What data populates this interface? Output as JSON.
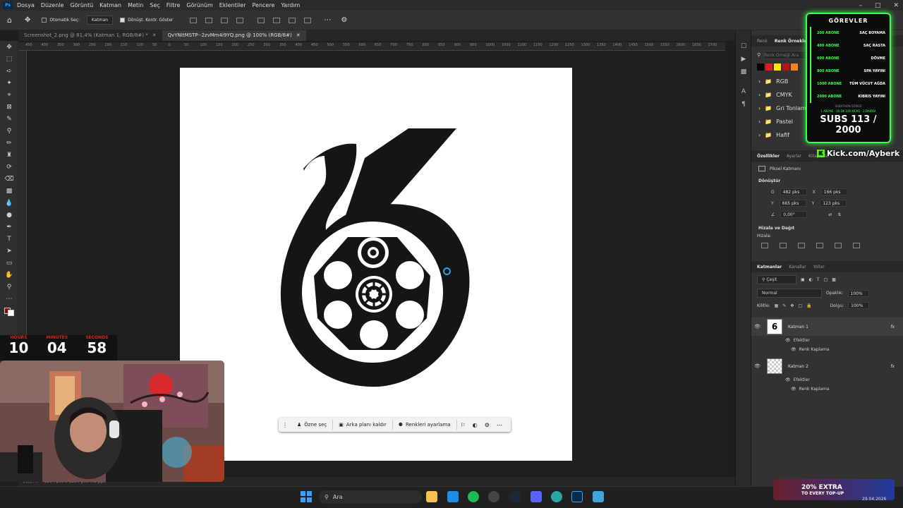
{
  "app": {
    "badge": "Ps"
  },
  "menu": [
    "Dosya",
    "Düzenle",
    "Görüntü",
    "Katman",
    "Metin",
    "Seç",
    "Filtre",
    "Görünüm",
    "Eklentiler",
    "Pencere",
    "Yardım"
  ],
  "options_bar": {
    "auto_select_label": "Otomatik Seç:",
    "auto_select_value": "Katman",
    "transform_controls_label": "Dönüşt. Kontr. Göster"
  },
  "tabs": [
    {
      "label": "Screenshot_2.png @ 81,4% (Katman 1, RGB/8#) *",
      "active": false
    },
    {
      "label": "QvYNItMSTP--2zvMm4i9YQ.png @ 100% (RGB/8#)",
      "active": true
    }
  ],
  "ruler_ticks": [
    "450",
    "400",
    "350",
    "300",
    "250",
    "200",
    "150",
    "100",
    "50",
    "0",
    "50",
    "100",
    "150",
    "200",
    "250",
    "300",
    "350",
    "400",
    "450",
    "500",
    "550",
    "600",
    "650",
    "700",
    "750",
    "800",
    "850",
    "900",
    "950",
    "1000",
    "1050",
    "1100",
    "1150",
    "1200",
    "1250",
    "1300",
    "1350",
    "1400",
    "1450",
    "1500",
    "1550",
    "1600",
    "1650",
    "1700"
  ],
  "context_bar": {
    "subject": "Özne seç",
    "remove_bg": "Arka planı kaldır",
    "adjust_colors": "Renkleri ayarlama"
  },
  "status_bar": {
    "zoom": "66,67%",
    "size": "1254 pks x 1254 pks (72 ppi)"
  },
  "right_panel": {
    "swatches_tabs": [
      "Renk",
      "Renk Örnekleri"
    ],
    "swatch_search_placeholder": "Renk Örneği Ara",
    "swatch_colors": [
      "#000000",
      "#e31b23",
      "#ffe500",
      "#b5121b",
      "#f58220"
    ],
    "swatch_folders": [
      "RGB",
      "CMYK",
      "Gri Tonlama",
      "Pastel",
      "Hafif"
    ],
    "props_tabs": [
      "Özellikler",
      "Ayarlar",
      "Kitaplıklar"
    ],
    "pixel_layer": "Piksel Katmanı",
    "transform_title": "Dönüştür",
    "W_label": "G",
    "W_value": "482 pks",
    "X_label": "X",
    "X_value": "166 pks",
    "H_label": "Y",
    "H_value": "665 pks",
    "Y_label": "Y",
    "Y_value": "123 pks",
    "angle": "0,00°",
    "align_title": "Hizala ve Dağıt",
    "align_sub": "Hizala:",
    "layers_tabs": [
      "Katmanlar",
      "Kanallar",
      "Yollar"
    ],
    "layer_filter": "Çeşit",
    "blend_mode": "Normal",
    "opacity_label": "Opaklık:",
    "opacity_value": "100%",
    "lock_label": "Kilitle:",
    "fill_label": "Dolgu:",
    "fill_value": "100%",
    "layers": [
      {
        "name": "Katman 1",
        "effects": "Efektler",
        "fx": "Renk Kaplama",
        "selected": true
      },
      {
        "name": "Katman 2",
        "effects": "Efektler",
        "fx": "Renk Kaplama",
        "selected": false
      }
    ]
  },
  "overlay_goals": {
    "title": "GÖREVLER",
    "goals": [
      {
        "goal": "200 ABONE",
        "reward": "SAÇ BOYAMA"
      },
      {
        "goal": "400 ABONE",
        "reward": "SAÇ RASTA"
      },
      {
        "goal": "600 ABONE",
        "reward": "DÖVME"
      },
      {
        "goal": "800 ABONE",
        "reward": "SPA YAYINI"
      },
      {
        "goal": "1000 ABONE",
        "reward": "TÜM VÜCUT AĞDA"
      },
      {
        "goal": "2000 ABONE",
        "reward": "KIBRIS YAYINI"
      }
    ],
    "timer_line": "SUBATHON SÜRESİ",
    "progress_line": "1 ABONE : 10 DK   100 KICKS : 2 DAKİKA",
    "subs": "SUBS 113 / 2000",
    "kick_handle": "Kick.com/Ayberk"
  },
  "overlay_timer": {
    "hours_label": "HOURS",
    "hours": "10",
    "minutes_label": "MINUTES",
    "minutes": "04",
    "seconds_label": "SECONDS",
    "seconds": "58"
  },
  "taskbar": {
    "search": "Ara",
    "promo_big": "20% EXTRA",
    "promo_small": "TO EVERY TOP-UP",
    "date": "29.04.2026"
  }
}
